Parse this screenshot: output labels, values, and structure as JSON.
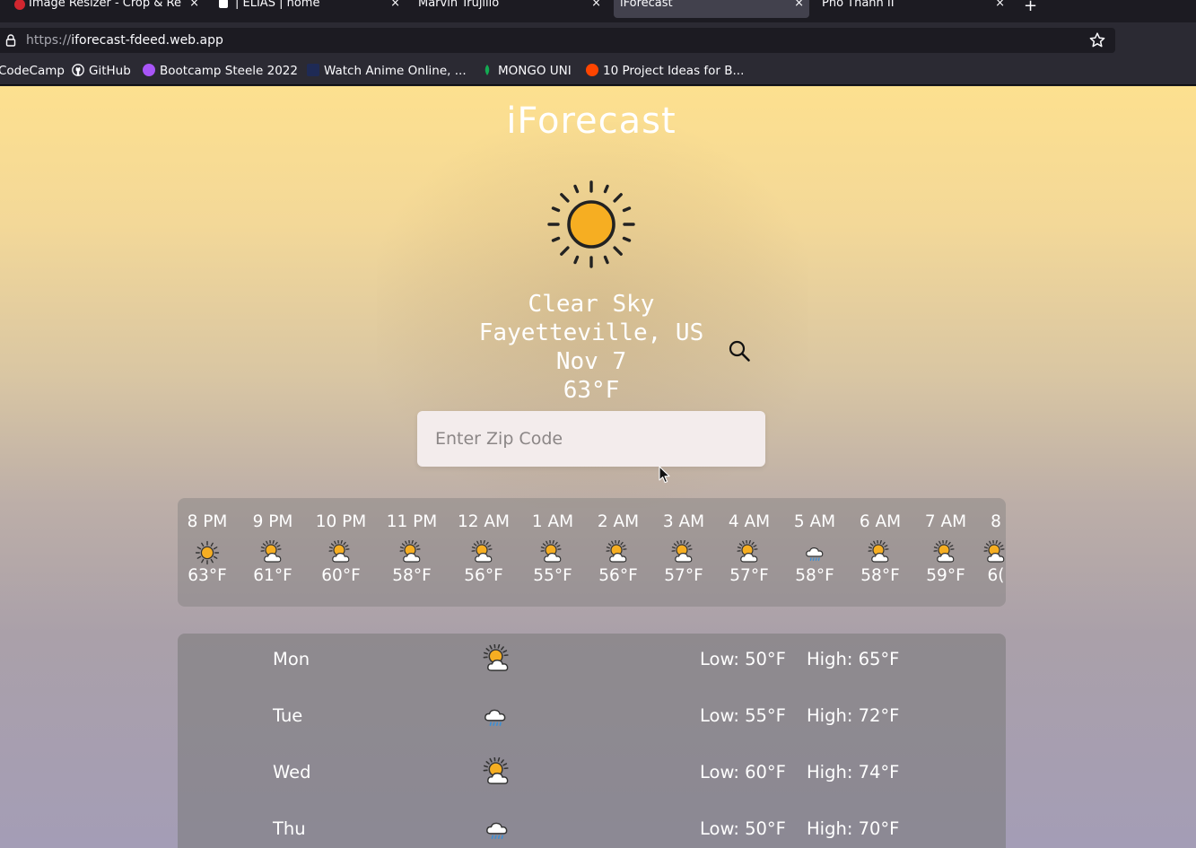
{
  "browser": {
    "tabs": [
      {
        "title": "Image Resizer - Crop & Re",
        "favicon_color": "#d1262f",
        "active": false
      },
      {
        "title": "| ELIAS | home",
        "favicon_color": "#ffffff",
        "active": false
      },
      {
        "title": "Marvin Trujillo",
        "favicon_color": "",
        "active": false
      },
      {
        "title": "iForecast",
        "favicon_color": "",
        "active": true
      },
      {
        "title": "Pho Thanh II",
        "favicon_color": "",
        "active": false
      }
    ],
    "tab_close": "×",
    "new_tab": "+",
    "url_protocol": "https://",
    "url_host": "iforecast-fdeed.web.app",
    "bookmarks": [
      {
        "label": "CodeCamp",
        "icon_color": ""
      },
      {
        "label": "GitHub",
        "icon_color": "#ffffff"
      },
      {
        "label": "Bootcamp Steele 2022",
        "icon_color": "#a855f7"
      },
      {
        "label": "Watch Anime Online, ...",
        "icon_color": "#1e2a55"
      },
      {
        "label": "MONGO UNI",
        "icon_color": "#13aa52"
      },
      {
        "label": "10 Project Ideas for B...",
        "icon_color": "#ff4500"
      }
    ]
  },
  "app": {
    "title": "iForecast",
    "current": {
      "icon": "sun-icon",
      "condition": "Clear Sky",
      "location": "Fayetteville, US",
      "date": "Nov 7",
      "temp": "63°F"
    },
    "search": {
      "placeholder": "Enter Zip Code",
      "value": ""
    },
    "hourly": [
      {
        "time": "8 PM",
        "icon": "sun-icon",
        "temp": "63°F"
      },
      {
        "time": "9 PM",
        "icon": "partly-cloudy-icon",
        "temp": "61°F"
      },
      {
        "time": "10 PM",
        "icon": "partly-cloudy-icon",
        "temp": "60°F"
      },
      {
        "time": "11 PM",
        "icon": "partly-cloudy-icon",
        "temp": "58°F"
      },
      {
        "time": "12 AM",
        "icon": "partly-cloudy-icon",
        "temp": "56°F"
      },
      {
        "time": "1 AM",
        "icon": "partly-cloudy-icon",
        "temp": "55°F"
      },
      {
        "time": "2 AM",
        "icon": "partly-cloudy-icon",
        "temp": "56°F"
      },
      {
        "time": "3 AM",
        "icon": "partly-cloudy-icon",
        "temp": "57°F"
      },
      {
        "time": "4 AM",
        "icon": "partly-cloudy-icon",
        "temp": "57°F"
      },
      {
        "time": "5 AM",
        "icon": "rain-cloud-icon",
        "temp": "58°F"
      },
      {
        "time": "6 AM",
        "icon": "partly-cloudy-icon",
        "temp": "58°F"
      },
      {
        "time": "7 AM",
        "icon": "partly-cloudy-icon",
        "temp": "59°F"
      },
      {
        "time": "8",
        "icon": "partly-cloudy-icon",
        "temp": "6("
      }
    ],
    "daily": [
      {
        "day": "Mon",
        "icon": "partly-cloudy-icon",
        "low": "Low: 50°F",
        "high": "High: 65°F"
      },
      {
        "day": "Tue",
        "icon": "rain-cloud-icon",
        "low": "Low: 55°F",
        "high": "High: 72°F"
      },
      {
        "day": "Wed",
        "icon": "partly-cloudy-icon",
        "low": "Low: 60°F",
        "high": "High: 74°F"
      },
      {
        "day": "Thu",
        "icon": "rain-cloud-icon",
        "low": "Low: 50°F",
        "high": "High: 70°F"
      }
    ]
  }
}
